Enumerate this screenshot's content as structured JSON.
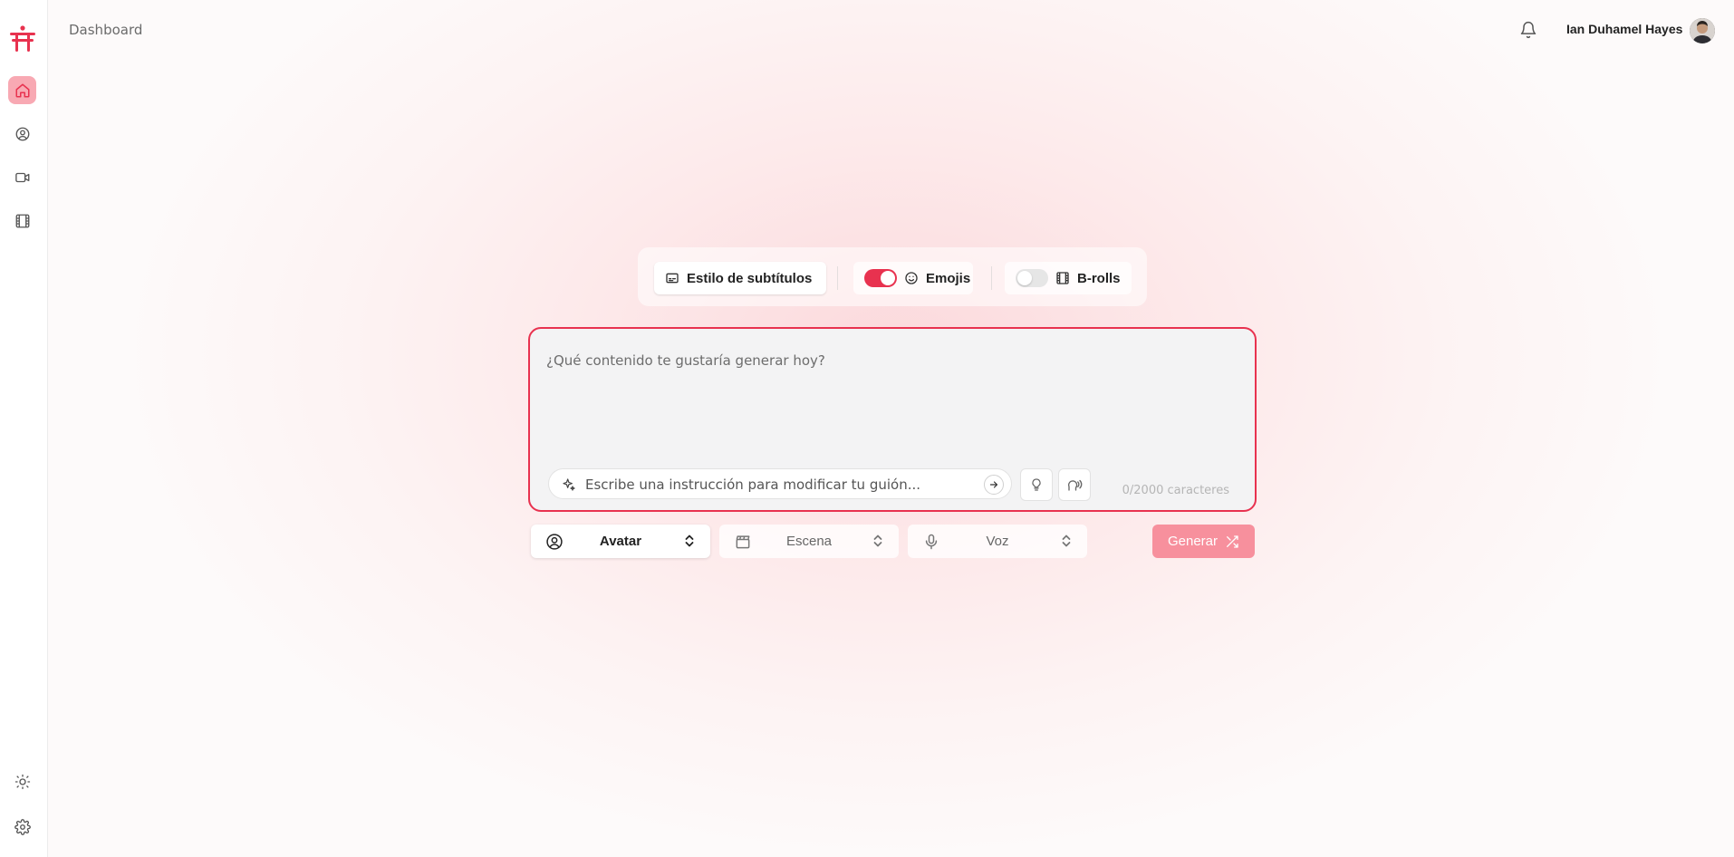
{
  "header": {
    "title": "Dashboard",
    "user_name": "Ian Duhamel Hayes"
  },
  "sidebar": {
    "items": [
      {
        "name": "home",
        "active": true
      },
      {
        "name": "avatars",
        "active": false
      },
      {
        "name": "videos",
        "active": false
      },
      {
        "name": "films",
        "active": false
      }
    ],
    "bottom": [
      "theme",
      "settings"
    ]
  },
  "options": {
    "subtitle_style_label": "Estilo de subtítulos",
    "emojis_label": "Emojis",
    "emojis_on": true,
    "brolls_label": "B-rolls",
    "brolls_on": false
  },
  "editor": {
    "prompt_placeholder": "¿Qué contenido te gustaría generar hoy?",
    "instruction_placeholder": "Escribe una instrucción para modificar tu guión...",
    "char_count": "0/2000 caracteres"
  },
  "selectors": {
    "avatar_label": "Avatar",
    "scene_label": "Escena",
    "voice_label": "Voz"
  },
  "generate_label": "Generar",
  "colors": {
    "accent": "#e8324f",
    "accent_light": "#f7909d"
  }
}
